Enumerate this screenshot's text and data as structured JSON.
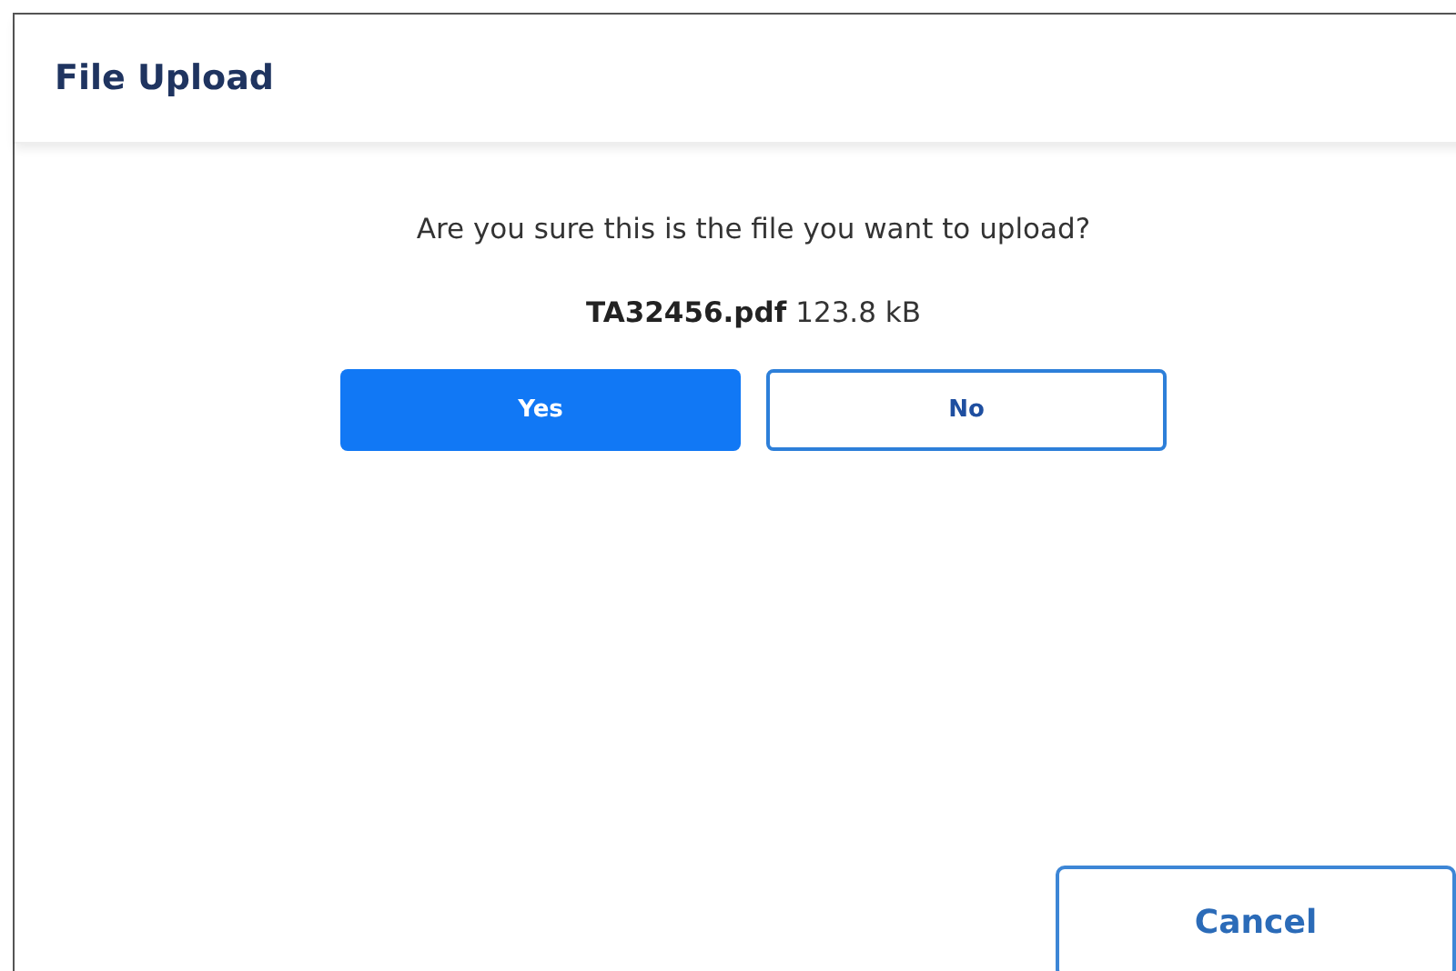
{
  "dialog": {
    "title": "File Upload",
    "question": "Are you sure this is the file you want to upload?",
    "file": {
      "name": "TA32456.pdf",
      "size": "123.8 kB"
    },
    "choices": [
      {
        "label": "Yes",
        "kind": "primary"
      },
      {
        "label": "No",
        "kind": "secondary"
      }
    ],
    "footer_button": "Cancel"
  }
}
